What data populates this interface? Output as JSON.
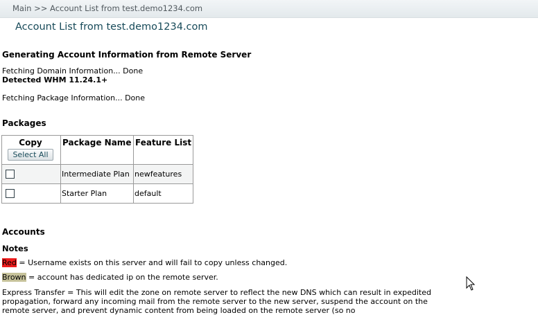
{
  "breadcrumb": "Main >> Account List from test.demo1234.com",
  "title": "Account List from test.demo1234.com",
  "generating": {
    "heading": "Generating Account Information from Remote Server",
    "domain_status": "Fetching Domain Information... Done",
    "whm_detected": "Detected WHM 11.24.1+",
    "package_status": "Fetching Package Information... Done"
  },
  "packages": {
    "heading": "Packages",
    "columns": {
      "copy": "Copy",
      "select_all": "Select All",
      "name": "Package Name",
      "features": "Feature List"
    },
    "rows": [
      {
        "name": "Intermediate Plan",
        "features": "newfeatures",
        "checked": false
      },
      {
        "name": "Starter Plan",
        "features": "default",
        "checked": false
      }
    ]
  },
  "accounts": {
    "heading": "Accounts",
    "notes_heading": "Notes",
    "red_tag": "Red",
    "red_text": " = Username exists on this server and will fail to copy unless changed.",
    "brown_tag": "Brown",
    "brown_text": " = account has dedicated ip on the remote server.",
    "express_transfer": "Express Transfer = This will edit the zone on remote server to reflect the new DNS which can result in expedited propagation, forward any incoming mail from the remote server to the new server, suspend the account on the remote server, and prevent dynamic content from being loaded on the remote server (so no"
  },
  "colors": {
    "title": "#174a59",
    "red_tag_bg": "#ee1c1c",
    "brown_tag_bg": "#c6c29a",
    "breadcrumb_bg": "#e8edf0"
  }
}
